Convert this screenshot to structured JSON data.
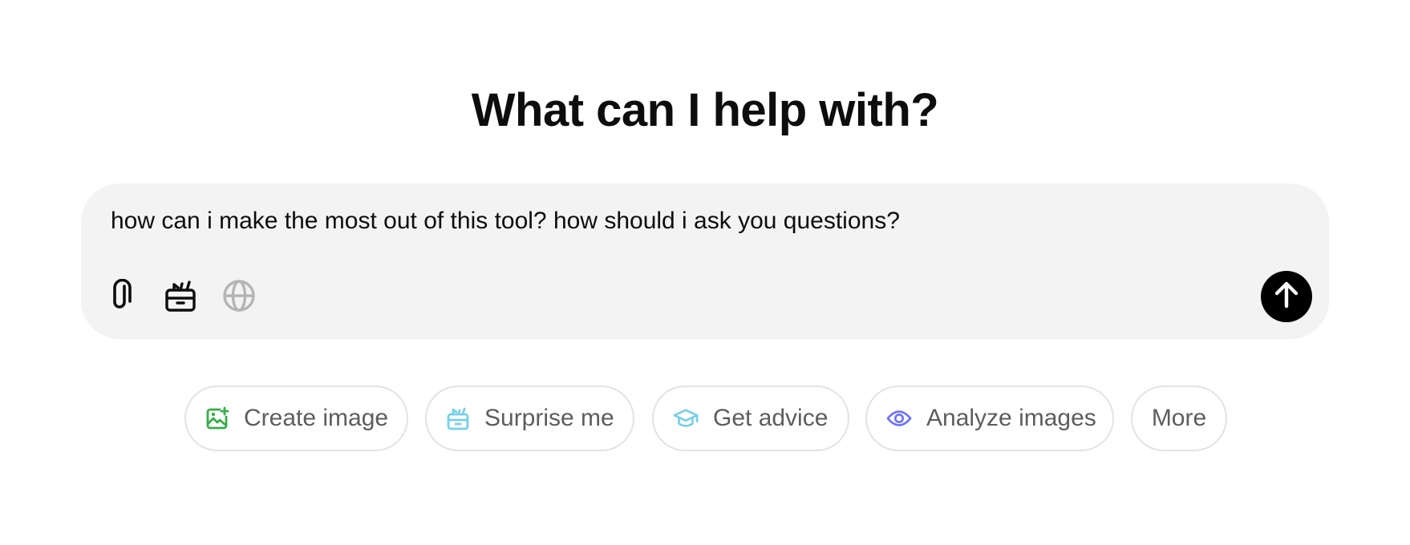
{
  "headline": "What can I help with?",
  "composer": {
    "input_value": "how can i make the most out of this tool? how should i ask you questions?",
    "tools": [
      {
        "icon": "paperclip-icon",
        "color": "#0d0d0d"
      },
      {
        "icon": "toolbox-icon",
        "color": "#0d0d0d"
      },
      {
        "icon": "globe-icon",
        "color": "#b4b4b4"
      }
    ],
    "send_icon": "arrow-up-icon"
  },
  "chips": [
    {
      "label": "Create image",
      "icon": "image-create-icon",
      "color": "#35ae47"
    },
    {
      "label": "Surprise me",
      "icon": "gift-box-icon",
      "color": "#76d0eb"
    },
    {
      "label": "Get advice",
      "icon": "graduation-cap-icon",
      "color": "#76d0eb"
    },
    {
      "label": "Analyze images",
      "icon": "eye-icon",
      "color": "#6c71ff"
    },
    {
      "label": "More"
    }
  ]
}
